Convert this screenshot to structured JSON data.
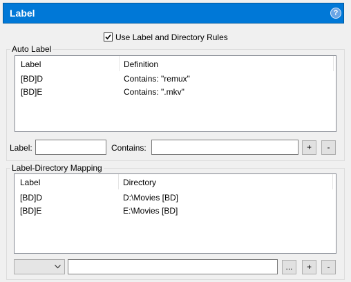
{
  "header": {
    "title": "Label",
    "help_icon": "?"
  },
  "use_rules": {
    "label": "Use Label and Directory Rules",
    "checked": true
  },
  "auto_label": {
    "group_title": "Auto Label",
    "columns": [
      "Label",
      "Definition"
    ],
    "rows": [
      {
        "label": "[BD]D",
        "definition": "Contains: \"remux\""
      },
      {
        "label": "[BD]E",
        "definition": "Contains: \".mkv\""
      }
    ],
    "label_field": {
      "caption": "Label:",
      "value": ""
    },
    "contains_field": {
      "caption": "Contains:",
      "value": ""
    },
    "add_button": "+",
    "remove_button": "-"
  },
  "mapping": {
    "group_title": "Label-Directory Mapping",
    "columns": [
      "Label",
      "Directory"
    ],
    "rows": [
      {
        "label": "[BD]D",
        "directory": "D:\\Movies [BD]"
      },
      {
        "label": "[BD]E",
        "directory": "E:\\Movies [BD]"
      }
    ],
    "combo_value": "",
    "path_value": "",
    "browse_button": "...",
    "add_button": "+",
    "remove_button": "-"
  }
}
